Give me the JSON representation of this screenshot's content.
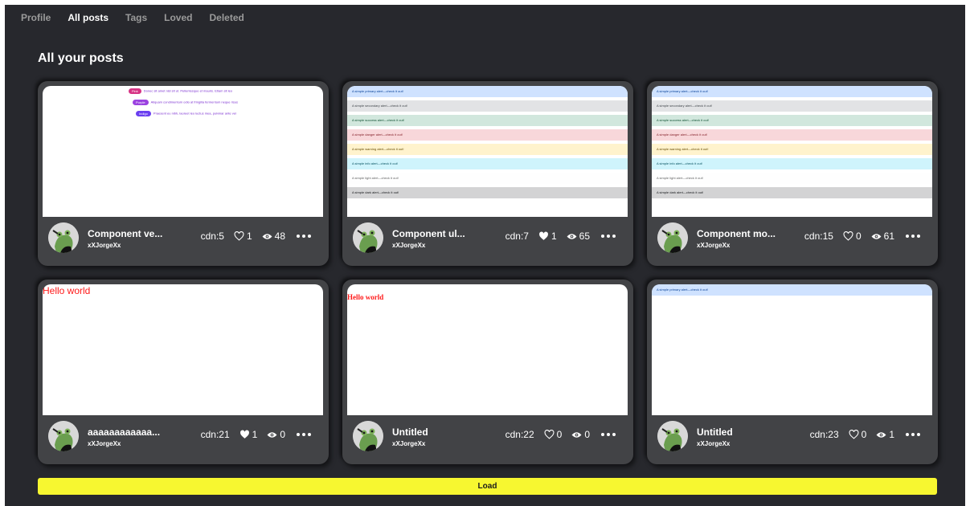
{
  "tabs": [
    {
      "label": "Profile",
      "active": false
    },
    {
      "label": "All posts",
      "active": true
    },
    {
      "label": "Tags",
      "active": false
    },
    {
      "label": "Loved",
      "active": false
    },
    {
      "label": "Deleted",
      "active": false
    }
  ],
  "page_title": "All your posts",
  "alert_texts": {
    "primary": "A simple primary alert—check it out!",
    "secondary": "A simple secondary alert—check it out!",
    "success": "A simple success alert—check it out!",
    "danger": "A simple danger alert—check it out!",
    "warning": "A simple warning alert—check it out!",
    "info": "A simple info alert—check it out!",
    "light": "A simple light alert—check it out!",
    "dark": "A simple dark alert—check it out!"
  },
  "badge_preview": {
    "rows": [
      {
        "badge": "Pink",
        "color": "#d63384",
        "text": "Donec sit amet nisl sit ut. Pellentesque et mauris. Etiam sit leo"
      },
      {
        "badge": "Purple",
        "color": "#9b42e0",
        "text": "Aliquam condimentum odio at fringilla fermentum neque risus"
      },
      {
        "badge": "Indigo",
        "color": "#6a3ff0",
        "text": "Praesent eu nibh, laoreet leo luctus mea, pulvinar ante vel"
      }
    ]
  },
  "preview_text": {
    "hello": "Hello world"
  },
  "posts": [
    {
      "title": "Component ve...",
      "author": "xXJorgeXx",
      "cdn": "cdn:5",
      "loves": "1",
      "loved": false,
      "views": "48"
    },
    {
      "title": "Component ul...",
      "author": "xXJorgeXx",
      "cdn": "cdn:7",
      "loves": "1",
      "loved": true,
      "views": "65"
    },
    {
      "title": "Component mo...",
      "author": "xXJorgeXx",
      "cdn": "cdn:15",
      "loves": "0",
      "loved": false,
      "views": "61"
    },
    {
      "title": "aaaaaaaaaaaa...",
      "author": "xXJorgeXx",
      "cdn": "cdn:21",
      "loves": "1",
      "loved": true,
      "views": "0"
    },
    {
      "title": "Untitled",
      "author": "xXJorgeXx",
      "cdn": "cdn:22",
      "loves": "0",
      "loved": false,
      "views": "0"
    },
    {
      "title": "Untitled",
      "author": "xXJorgeXx",
      "cdn": "cdn:23",
      "loves": "0",
      "loved": false,
      "views": "1"
    }
  ],
  "load_label": "Load",
  "colors": {
    "background": "#27282d",
    "card": "#424346",
    "load_button": "#f7f730",
    "hello_text": "#ff1a1a"
  },
  "icons": {
    "love_empty": "heart-outline-icon",
    "love_filled": "heart-filled-icon",
    "views": "eye-icon",
    "more": "ellipsis-icon",
    "avatar": "frog-avatar"
  }
}
